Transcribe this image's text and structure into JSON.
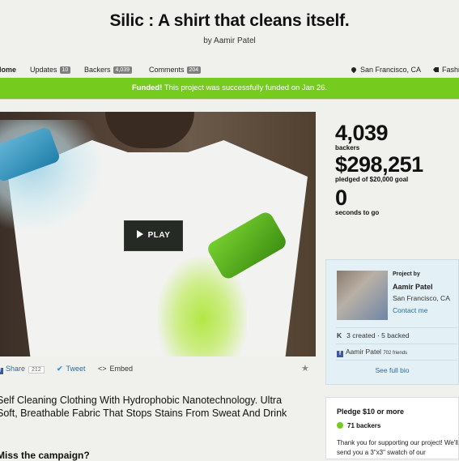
{
  "project": {
    "title": "Silic : A shirt that cleans itself.",
    "byline_prefix": "by",
    "creator_name": "Aamir Patel"
  },
  "nav": {
    "home": "Home",
    "updates_label": "Updates",
    "updates_count": "10",
    "backers_label": "Backers",
    "backers_count": "4,039",
    "comments_label": "Comments",
    "comments_count": "204",
    "location": "San Francisco, CA",
    "category": "Fashion"
  },
  "banner": {
    "strong": "Funded!",
    "text": " This project was successfully funded on Jan 26."
  },
  "video": {
    "play_label": "PLAY"
  },
  "share": {
    "share_label": "Share",
    "share_count": "212",
    "tweet_label": "Tweet",
    "embed_label": "Embed"
  },
  "blurb": "Self Cleaning Clothing With Hydrophobic Nanotechnology. Ultra Soft, Breathable Fabric That Stops Stains From Sweat And Drink",
  "section_cut": "Miss the campaign?",
  "stats": {
    "backers_num": "4,039",
    "backers_lbl": "backers",
    "pledged_num": "$298,251",
    "pledged_lbl": "pledged of $20,000 goal",
    "seconds_num": "0",
    "seconds_lbl": "seconds to go"
  },
  "creator": {
    "project_by": "Project by",
    "name": "Aamir Patel",
    "location": "San Francisco, CA",
    "contact": "Contact me",
    "history": "3 created · 5 backed",
    "fb_name": "Aamir Patel",
    "fb_friends": "702 friends",
    "see_bio": "See full bio"
  },
  "pledge": {
    "title": "Pledge $10 or more",
    "backers": "71 backers",
    "description": "Thank you for supporting our project! We'll send you a 3\"x3\" swatch of our"
  },
  "colors": {
    "accent_green": "#76cc1e",
    "link_blue": "#2c6da5",
    "creator_box": "#e3f0f6"
  }
}
